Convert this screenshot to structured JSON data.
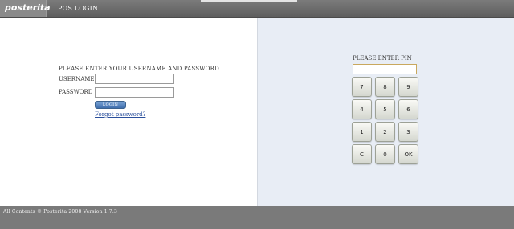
{
  "header": {
    "logo_text": "posterita",
    "title": "POS LOGIN"
  },
  "login": {
    "heading": "PLEASE ENTER YOUR USERNAME AND PASSWORD",
    "username_label": "USERNAME",
    "username_value": "",
    "password_label": "PASSWORD",
    "password_value": "",
    "login_button": "LOGIN",
    "forgot_link": "Forgot password?"
  },
  "pin": {
    "heading": "PLEASE ENTER PIN",
    "value": "",
    "keys": [
      "7",
      "8",
      "9",
      "4",
      "5",
      "6",
      "1",
      "2",
      "3",
      "C",
      "0",
      "OK"
    ]
  },
  "footer": {
    "text": "All Contents © Posterita 2008 Version 1.7.3"
  },
  "colors": {
    "topbar": "#666666",
    "right_panel": "#e8edf5",
    "footer": "#7a7a7a",
    "login_button": "#4a78b5",
    "link": "#2a4f9c"
  }
}
